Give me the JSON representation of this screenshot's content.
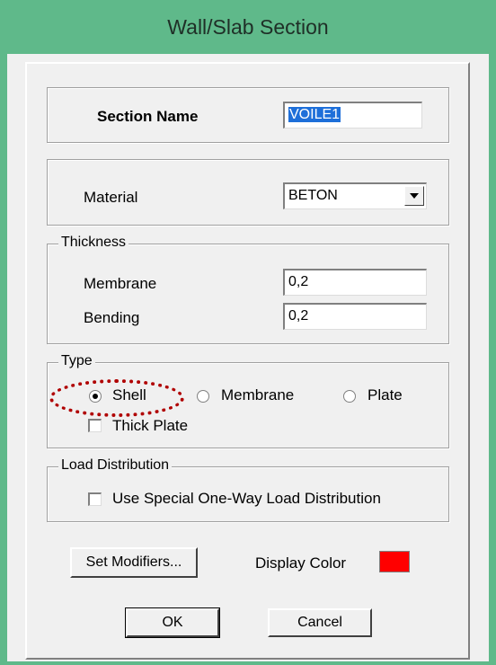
{
  "window": {
    "title": "Wall/Slab Section"
  },
  "section": {
    "label": "Section Name",
    "value": "VOILE1"
  },
  "material": {
    "label": "Material",
    "value": "BETON"
  },
  "thickness": {
    "legend": "Thickness",
    "membrane_label": "Membrane",
    "membrane_value": "0,2",
    "bending_label": "Bending",
    "bending_value": "0,2"
  },
  "type": {
    "legend": "Type",
    "options": [
      {
        "label": "Shell",
        "checked": true
      },
      {
        "label": "Membrane",
        "checked": false
      },
      {
        "label": "Plate",
        "checked": false
      }
    ],
    "thick_plate_label": "Thick Plate"
  },
  "load_distribution": {
    "legend": "Load Distribution",
    "checkbox_label": "Use Special One-Way Load Distribution"
  },
  "buttons": {
    "set_modifiers": "Set Modifiers...",
    "display_color_label": "Display Color",
    "ok": "OK",
    "cancel": "Cancel"
  },
  "colors": {
    "frame": "#5fb98a",
    "display_color": "#ff0000",
    "annotation": "#b00000"
  }
}
